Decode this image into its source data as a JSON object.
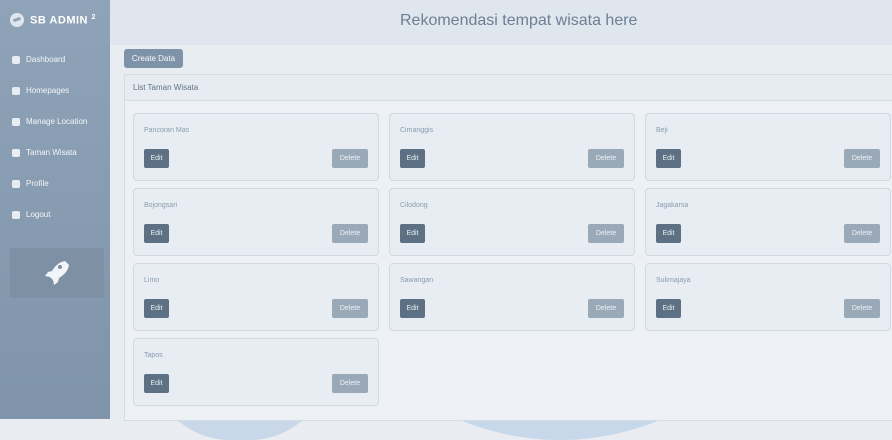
{
  "sidebar": {
    "brand": "SB ADMIN",
    "brand_sup": "2",
    "items": [
      {
        "label": "Dashboard",
        "icon": "dashboard-icon"
      },
      {
        "label": "Homepages",
        "icon": "home-icon"
      },
      {
        "label": "Manage Location",
        "icon": "location-icon"
      },
      {
        "label": "Taman Wisata",
        "icon": "park-icon"
      },
      {
        "label": "Profile",
        "icon": "user-icon"
      },
      {
        "label": "Logout",
        "icon": "logout-icon"
      }
    ]
  },
  "header": {
    "title": "Rekomendasi tempat wisata here"
  },
  "toolbar": {
    "create_label": "Create Data"
  },
  "list": {
    "title": "List Taman Wisata",
    "edit_label": "Edit",
    "delete_label": "Delete",
    "items": [
      {
        "name": "Pancoran Mas"
      },
      {
        "name": "Cimanggis"
      },
      {
        "name": "Beji"
      },
      {
        "name": "Bojongsari"
      },
      {
        "name": "Cilodong"
      },
      {
        "name": "Jagakarsa"
      },
      {
        "name": "Limo"
      },
      {
        "name": "Sawangan"
      },
      {
        "name": "Sukmajaya"
      },
      {
        "name": "Tapos"
      }
    ]
  },
  "colors": {
    "sidebar": "#8fa3b8",
    "primary": "#5e7184",
    "muted": "#9aa9b8"
  }
}
